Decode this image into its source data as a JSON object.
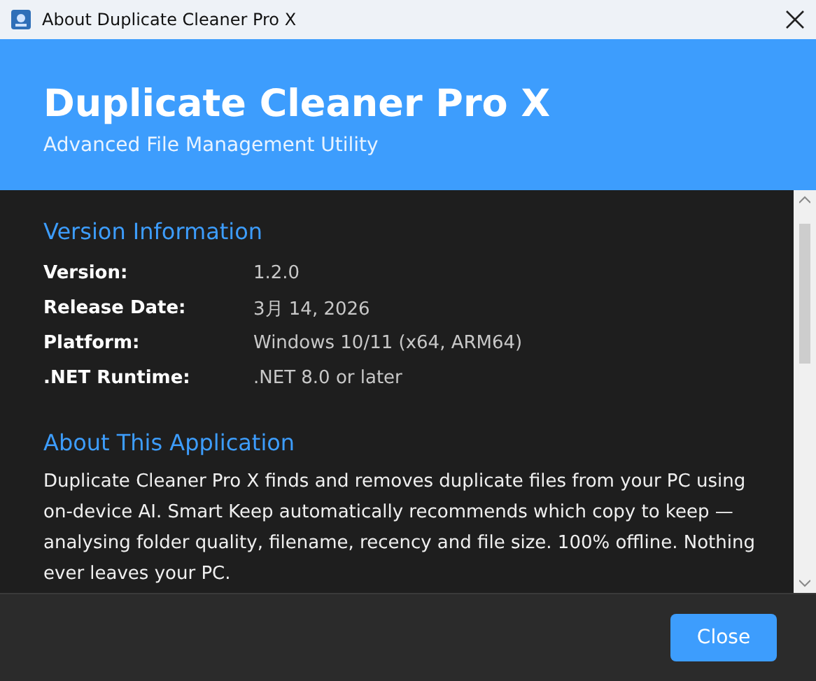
{
  "window": {
    "title": "About Duplicate Cleaner Pro X"
  },
  "header": {
    "title": "Duplicate Cleaner Pro X",
    "subtitle": "Advanced File Management Utility"
  },
  "version_section": {
    "heading": "Version Information",
    "rows": [
      {
        "label": "Version:",
        "value": "1.2.0"
      },
      {
        "label": "Release Date:",
        "value": "3月 14, 2026"
      },
      {
        "label": "Platform:",
        "value": "Windows 10/11 (x64, ARM64)"
      },
      {
        "label": ".NET Runtime:",
        "value": ".NET 8.0 or later"
      }
    ]
  },
  "about_section": {
    "heading": "About This Application",
    "text": "Duplicate Cleaner Pro X finds and removes duplicate files from your PC using on-device AI. Smart Keep automatically recommends which copy to keep — analysing folder quality, filename, recency and file size. 100% offline. Nothing ever leaves your PC."
  },
  "buttons": [
    "Close"
  ]
}
